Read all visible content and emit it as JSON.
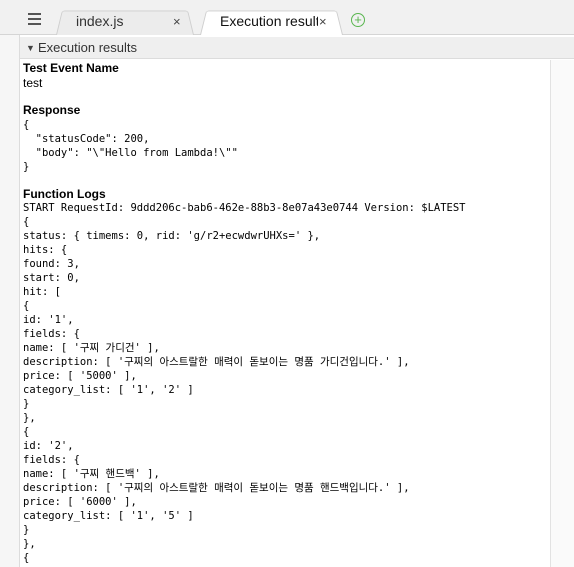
{
  "tabs": [
    {
      "label": "index.js",
      "close": "×"
    },
    {
      "label": "Execution results",
      "close": "×"
    }
  ],
  "add_tab": "+",
  "section": {
    "caret": "▼",
    "title": "Execution results"
  },
  "test_event": {
    "heading": "Test Event Name",
    "value": "test"
  },
  "response": {
    "heading": "Response",
    "lines": [
      "{",
      "  \"statusCode\": 200,",
      "  \"body\": \"\\\"Hello from Lambda!\\\"\"",
      "}"
    ]
  },
  "logs": {
    "heading": "Function Logs",
    "lines": [
      "START RequestId: 9ddd206c-bab6-462e-88b3-8e07a43e0744 Version: $LATEST",
      "{",
      "status: { timems: 0, rid: 'g/r2+ecwdwrUHXs=' },",
      "hits: {",
      "found: 3,",
      "start: 0,",
      "hit: [",
      "{",
      "id: '1',",
      "fields: {",
      "name: [ '구찌 가디건' ],",
      "description: [ '구찌의 아스트랄한 매력이 돋보이는 명품 가디건입니다.' ],",
      "price: [ '5000' ],",
      "category_list: [ '1', '2' ]",
      "}",
      "},",
      "{",
      "id: '2',",
      "fields: {",
      "name: [ '구찌 핸드백' ],",
      "description: [ '구찌의 아스트랄한 매력이 돋보이는 명품 핸드백입니다.' ],",
      "price: [ '6000' ],",
      "category_list: [ '1', '5' ]",
      "}",
      "},",
      "{"
    ]
  }
}
